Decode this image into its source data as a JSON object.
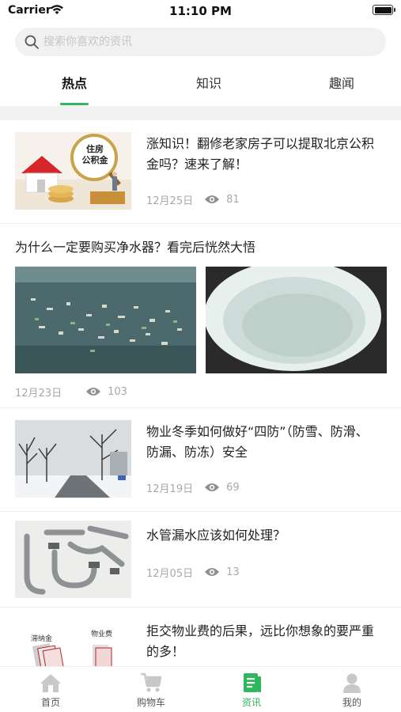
{
  "status": {
    "carrier": "Carrier",
    "time": "11:10 PM"
  },
  "search": {
    "placeholder": "搜索你喜欢的资讯"
  },
  "tabs": [
    {
      "label": "热点",
      "active": true
    },
    {
      "label": "知识",
      "active": false
    },
    {
      "label": "趣闻",
      "active": false
    }
  ],
  "feed": [
    {
      "title": "涨知识！翻修老家房子可以提取北京公积金吗？速来了解！",
      "date": "12月25日",
      "views": "81",
      "thumb_text": "住房\n公积金"
    },
    {
      "title": "为什么一定要购买净水器？看完后恍然大悟",
      "date": "12月23日",
      "views": "103"
    },
    {
      "title": "物业冬季如何做好“四防”（防雪、防滑、防漏、防冻）安全",
      "date": "12月19日",
      "views": "69"
    },
    {
      "title": "水管漏水应该如何处理？",
      "date": "12月05日",
      "views": "13"
    },
    {
      "title": "拒交物业费的后果，远比你想象的要严重的多！",
      "thumb_labels": [
        "滞纳金",
        "物业费"
      ]
    }
  ],
  "tabbar": [
    {
      "label": "首页",
      "icon": "home-icon",
      "active": false
    },
    {
      "label": "购物车",
      "icon": "cart-icon",
      "active": false
    },
    {
      "label": "资讯",
      "icon": "news-icon",
      "active": true
    },
    {
      "label": "我的",
      "icon": "profile-icon",
      "active": false
    }
  ],
  "colors": {
    "accent": "#2fb75e",
    "meta": "#a8a8a8",
    "inactive_icon": "#c8c8c8"
  }
}
